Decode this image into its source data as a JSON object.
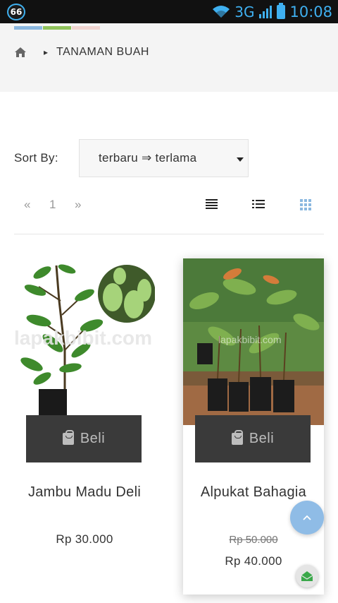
{
  "status_bar": {
    "badge": "66",
    "network": "3G",
    "time": "10:08"
  },
  "breadcrumb": {
    "home_icon": "home-icon",
    "current": "TANAMAN BUAH"
  },
  "accent_colors": [
    "#8bb8e0",
    "#8fc25a",
    "#f0d4d0"
  ],
  "sort": {
    "label": "Sort By:",
    "selected": "terbaru ⇒ terlama"
  },
  "pager": {
    "prev": "«",
    "page": "1",
    "next": "»"
  },
  "view_modes": [
    "list-view-icon",
    "detailed-list-icon",
    "grid-view-icon"
  ],
  "products": [
    {
      "buy_label": "Beli",
      "name": "Jambu Madu Deli",
      "price": "Rp 30.000",
      "image_watermark": "lapakbibit.com"
    },
    {
      "buy_label": "Beli",
      "name": "Alpukat Bahagia",
      "old_price": "Rp 50.000",
      "price": "Rp 40.000",
      "image_watermark": "lapakbibit.com"
    }
  ]
}
